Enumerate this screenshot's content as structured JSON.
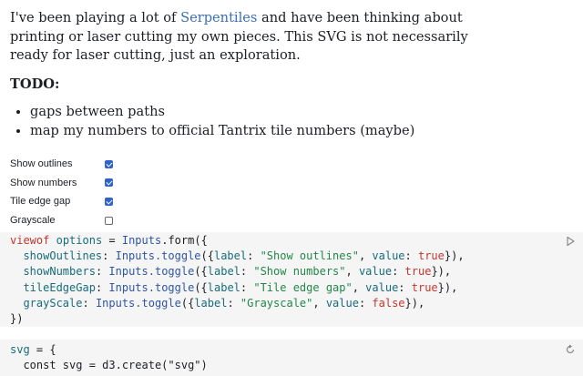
{
  "intro": {
    "before_link": "I've been playing a lot of ",
    "link": "Serpentiles",
    "after_link": " and have been thinking about printing or laser cutting my own pieces. This SVG is not necessarily ready for laser cutting, just an exploration."
  },
  "todo": {
    "heading": "TODO:",
    "items": [
      "gaps between paths",
      "map my numbers to official Tantrix tile numbers (maybe)"
    ]
  },
  "form": {
    "fields": [
      {
        "label": "Show outlines",
        "checked": true
      },
      {
        "label": "Show numbers",
        "checked": true
      },
      {
        "label": "Tile edge gap",
        "checked": true
      },
      {
        "label": "Grayscale",
        "checked": false
      }
    ]
  },
  "cell1": {
    "l1_viewof": "viewof",
    "l1_options": "options",
    "l1_eq": " = ",
    "l1_inputs": "Inputs",
    "l1_form": ".form({",
    "rows": [
      {
        "key": "showOutlines",
        "fn": "Inputs.toggle",
        "label": "\"Show outlines\"",
        "value": "true"
      },
      {
        "key": "showNumbers",
        "fn": "Inputs.toggle",
        "label": "\"Show numbers\"",
        "value": "true"
      },
      {
        "key": "tileEdgeGap",
        "fn": "Inputs.toggle",
        "label": "\"Tile edge gap\"",
        "value": "true"
      },
      {
        "key": "grayScale",
        "fn": "Inputs.toggle",
        "label": "\"Grayscale\"",
        "value": "false"
      }
    ],
    "close": "})"
  },
  "cell2": {
    "l1_svg": "svg",
    "l1_rest": " = {",
    "l2": "  const svg = d3.create(\"svg\")"
  },
  "icons": {
    "run": "play-icon",
    "refresh": "refresh-icon"
  },
  "colors": {
    "link": "#3b6fb3",
    "checkbox": "#2f63c9",
    "keyword": "#c5352c",
    "string": "#22864a",
    "fn": "#2f55a4"
  }
}
